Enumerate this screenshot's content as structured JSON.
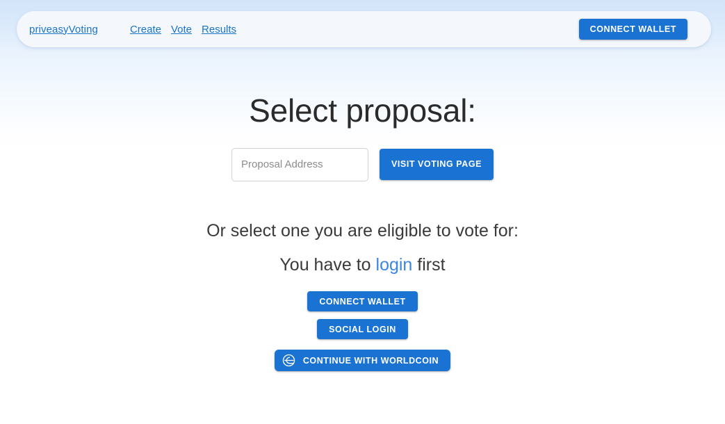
{
  "header": {
    "brand": "priveasyVoting",
    "nav_links": [
      {
        "label": "Create"
      },
      {
        "label": "Vote"
      },
      {
        "label": "Results"
      }
    ],
    "connect_wallet_label": "CONNECT WALLET"
  },
  "main": {
    "title": "Select proposal:",
    "proposal_input_placeholder": "Proposal Address",
    "proposal_input_value": "",
    "visit_voting_page_label": "VISIT VOTING PAGE",
    "eligible_text": "Or select one you are eligible to vote for:",
    "login_prefix": "You have to ",
    "login_link": "login",
    "login_suffix": " first",
    "connect_wallet_label": "CONNECT WALLET",
    "social_login_label": "SOCIAL LOGIN",
    "worldcoin_label": "CONTINUE WITH WORLDCOIN",
    "worldcoin_icon": "worldcoin-orb-icon"
  },
  "colors": {
    "accent_blue": "#1a73d2",
    "link_blue": "#1a73c8",
    "login_link_blue": "#3b86e0",
    "page_top_bg": "#d3e4fa",
    "navbar_bg": "#f4f8fd",
    "input_border": "#d2d2d2",
    "placeholder": "#8c8c8c",
    "heading": "#2b2b2b"
  }
}
